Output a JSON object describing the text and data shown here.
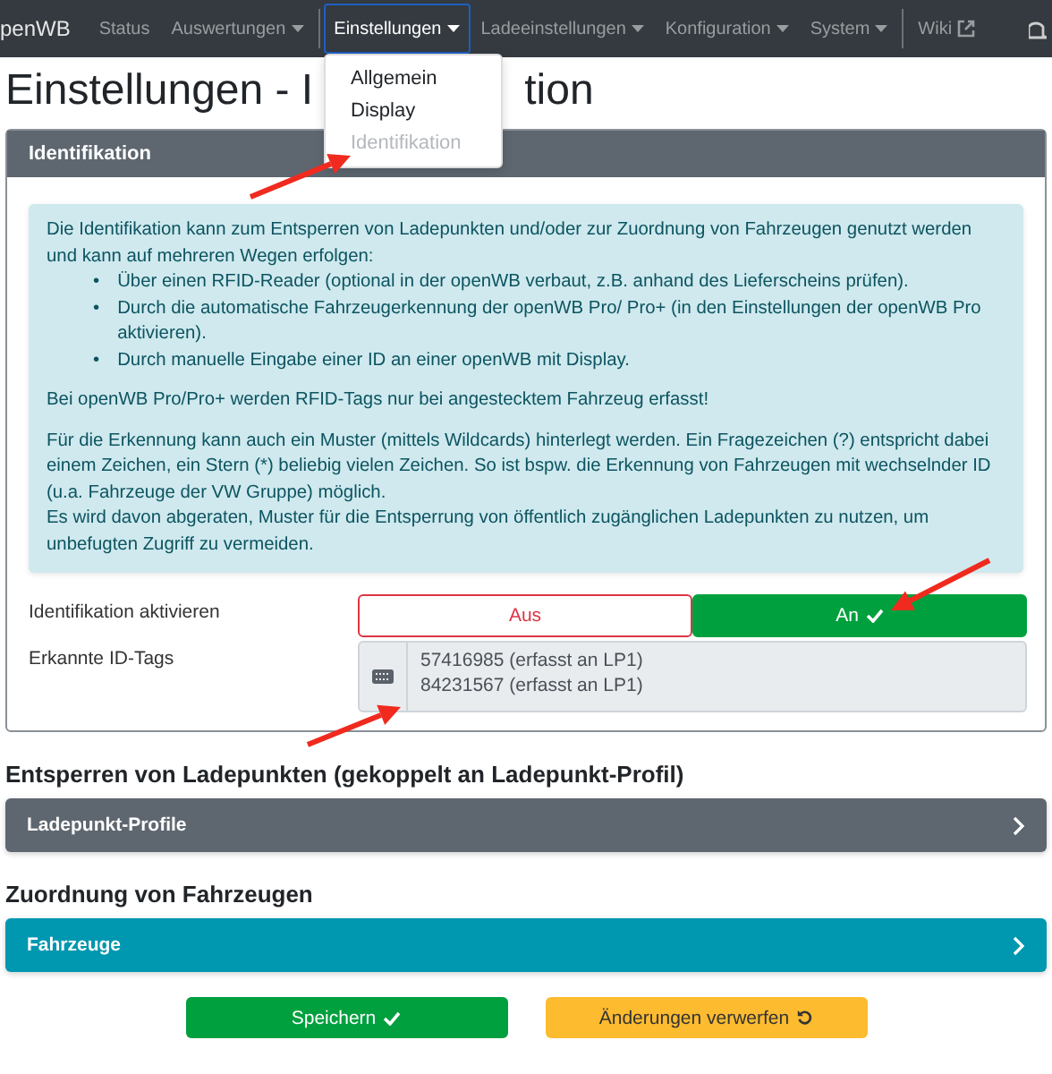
{
  "navbar": {
    "brand": "penWB",
    "items": [
      {
        "label": "Status",
        "kind": "link",
        "active": false,
        "divider_before": false
      },
      {
        "label": "Auswertungen",
        "kind": "dropdown",
        "active": false,
        "divider_before": false
      },
      {
        "label": "Einstellungen",
        "kind": "dropdown",
        "active": true,
        "divider_before": true
      },
      {
        "label": "Ladeeinstellungen",
        "kind": "dropdown",
        "active": false,
        "divider_before": false
      },
      {
        "label": "Konfiguration",
        "kind": "dropdown",
        "active": false,
        "divider_before": false
      },
      {
        "label": "System",
        "kind": "dropdown",
        "active": false,
        "divider_before": false
      },
      {
        "label": "Wiki",
        "kind": "external",
        "active": false,
        "divider_before": true
      }
    ]
  },
  "dropdown_menu": {
    "items": [
      {
        "label": "Allgemein",
        "selected": false
      },
      {
        "label": "Display",
        "selected": false
      },
      {
        "label": "Identifikation",
        "selected": true
      }
    ]
  },
  "page_title": {
    "visible_start": "Einstellungen - I",
    "visible_end": "tion"
  },
  "identification_card": {
    "title": "Identifikation",
    "info_blocks": [
      {
        "kind": "paragraph",
        "text": "Die Identifikation kann zum Entsperren von Ladepunkten und/oder zur Zuordnung von Fahrzeugen genutzt werden und kann auf mehreren Wegen erfolgen:"
      },
      {
        "kind": "list",
        "marker": "•",
        "items": [
          "Über einen RFID-Reader (optional in der openWB verbaut, z.B. anhand des Lieferscheins prüfen).",
          "Durch die automatische Fahrzeugerkennung der openWB Pro/ Pro+ (in den Einstellungen der openWB Pro aktivieren).",
          "Durch manuelle Eingabe einer ID an einer openWB mit Display."
        ]
      },
      {
        "kind": "paragraph",
        "text": "Bei openWB Pro/Pro+ werden RFID-Tags nur bei angestecktem Fahrzeug erfasst!"
      },
      {
        "kind": "paragraph",
        "text": "Für die Erkennung kann auch ein Muster (mittels Wildcards) hinterlegt werden. Ein Fragezeichen (?) entspricht dabei einem Zeichen, ein Stern (*) beliebig vielen Zeichen. So ist bspw. die Erkennung von Fahrzeugen mit wechselnder ID (u.a. Fahrzeuge der VW Gruppe) möglich."
      },
      {
        "kind": "line",
        "text": "Es wird davon abgeraten, Muster für die Entsperrung von öffentlich zugänglichen Ladepunkten zu nutzen, um unbefugten Zugriff zu vermeiden."
      }
    ],
    "toggle": {
      "label": "Identifikation aktivieren",
      "options": [
        {
          "label": "Aus",
          "kind": "off",
          "selected": false
        },
        {
          "label": "An",
          "kind": "on",
          "selected": true
        }
      ]
    },
    "id_tags": {
      "label": "Erkannte ID-Tags",
      "lines": [
        "57416985 (erfasst an LP1)",
        "84231567 (erfasst an LP1)"
      ]
    }
  },
  "sections": [
    {
      "heading": "Entsperren von Ladepunkten (gekoppelt an Ladepunkt-Profil)",
      "bar": {
        "label": "Ladepunkt-Profile",
        "kind": "secondary"
      }
    },
    {
      "heading": "Zuordnung von Fahrzeugen",
      "bar": {
        "label": "Fahrzeuge",
        "kind": "info"
      }
    }
  ],
  "buttons": [
    {
      "label": "Speichern",
      "kind": "save"
    },
    {
      "label": "Änderungen verwerfen",
      "kind": "reset"
    }
  ]
}
